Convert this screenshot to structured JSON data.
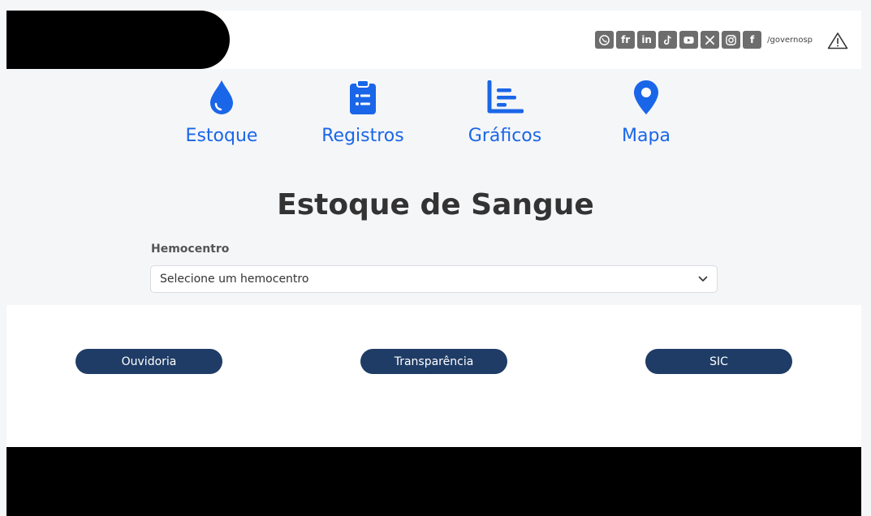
{
  "social": {
    "items": [
      {
        "icon": "whatsapp-icon"
      },
      {
        "icon": "flickr-icon",
        "text": "fr"
      },
      {
        "icon": "linkedin-icon",
        "text": "in"
      },
      {
        "icon": "tiktok-icon"
      },
      {
        "icon": "youtube-icon"
      },
      {
        "icon": "x-icon"
      },
      {
        "icon": "instagram-icon"
      },
      {
        "icon": "facebook-icon",
        "text": "f"
      }
    ],
    "handle": "/governosp"
  },
  "nav": {
    "items": [
      {
        "label": "Estoque",
        "icon": "drop-icon"
      },
      {
        "label": "Registros",
        "icon": "clipboard-list-icon"
      },
      {
        "label": "Gráficos",
        "icon": "chart-icon"
      },
      {
        "label": "Mapa",
        "icon": "map-pin-icon"
      }
    ]
  },
  "main": {
    "title": "Estoque de Sangue",
    "hemocentro_label": "Hemocentro",
    "hemocentro_select": "Selecione um hemocentro"
  },
  "links": {
    "ouvidoria": "Ouvidoria",
    "transparencia": "Transparência",
    "sic": "SIC"
  },
  "colors": {
    "accent": "#1a66e8",
    "pill": "#1f3c66"
  }
}
